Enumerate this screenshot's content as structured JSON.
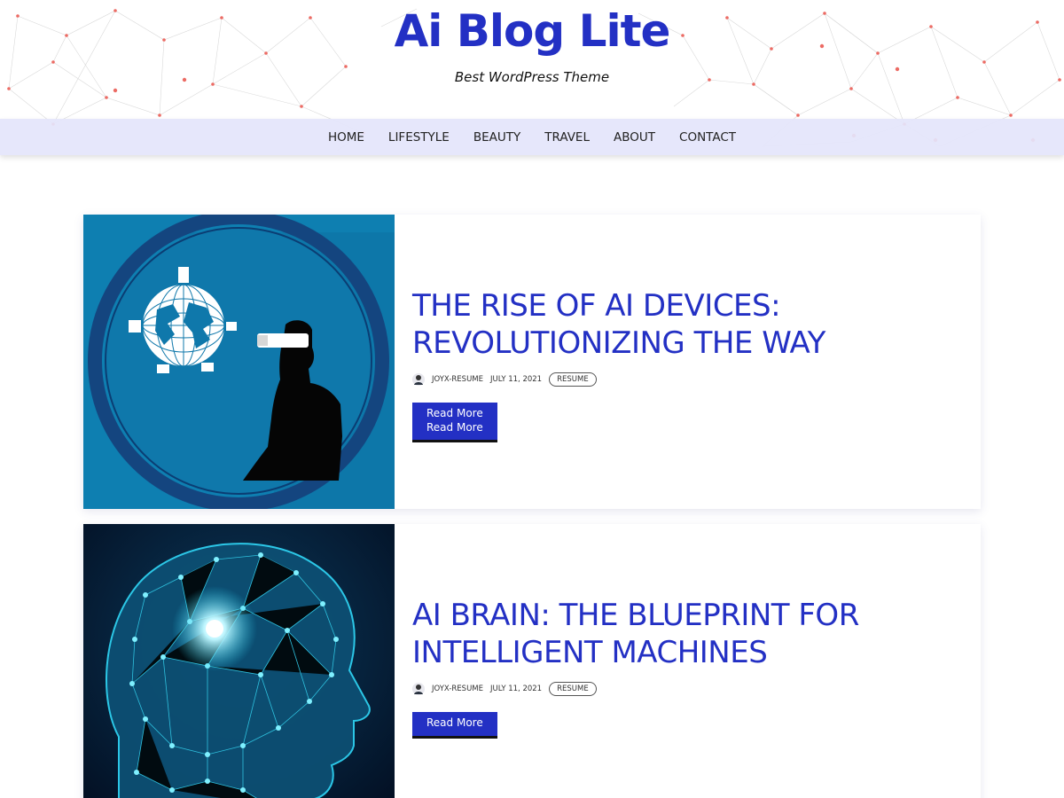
{
  "site": {
    "title": "Ai Blog Lite",
    "tagline": "Best WordPress Theme"
  },
  "nav": {
    "items": [
      "HOME",
      "LIFESTYLE",
      "BEAUTY",
      "TRAVEL",
      "ABOUT",
      "CONTACT"
    ]
  },
  "colors": {
    "accent": "#2330c4",
    "nav_bg": "#e4e5fb",
    "network_dots": "#e8605a"
  },
  "posts": [
    {
      "title": "THE RISE OF AI DEVICES: REVOLUTIONIZING THE WAY",
      "author": "JOYX-RESUME",
      "date": "JULY 11, 2021",
      "tag": "RESUME",
      "read_more": "Read More",
      "read_more_repeat": "Read More",
      "image": "vr-headset-globe-illustration"
    },
    {
      "title": "AI BRAIN: THE BLUEPRINT FOR INTELLIGENT MACHINES",
      "author": "JOYX-RESUME",
      "date": "JULY 11, 2021",
      "tag": "RESUME",
      "read_more": "Read More",
      "image": "glowing-network-head-illustration"
    }
  ]
}
